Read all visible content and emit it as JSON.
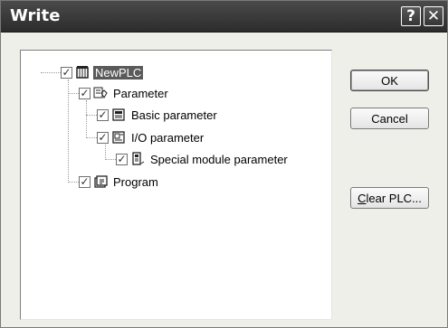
{
  "window": {
    "title": "Write",
    "help_label": "?",
    "close_label": "✕"
  },
  "tree": {
    "nodes": [
      {
        "label": "NewPLC",
        "checked": true,
        "icon": "plc-icon",
        "selected": true
      },
      {
        "label": "Parameter",
        "checked": true,
        "icon": "parameter-icon"
      },
      {
        "label": "Basic parameter",
        "checked": true,
        "icon": "basic-parameter-icon"
      },
      {
        "label": "I/O parameter",
        "checked": true,
        "icon": "io-parameter-icon"
      },
      {
        "label": "Special module parameter",
        "checked": true,
        "icon": "special-module-icon"
      },
      {
        "label": "Program",
        "checked": true,
        "icon": "program-icon"
      }
    ],
    "check_glyph": "✓"
  },
  "buttons": {
    "ok": "OK",
    "cancel": "Cancel",
    "clear_plc_mnemonic": "C",
    "clear_plc_rest": "lear PLC..."
  }
}
